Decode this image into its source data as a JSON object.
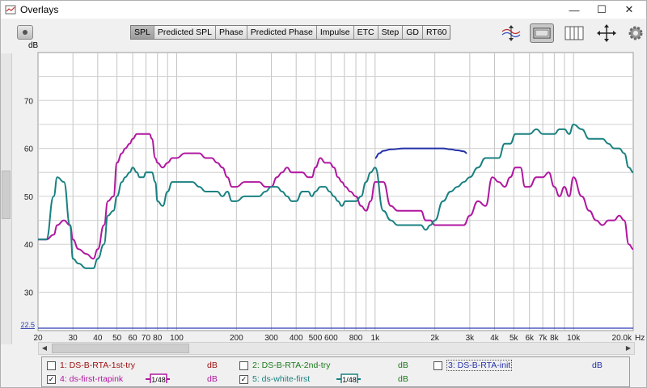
{
  "window": {
    "title": "Overlays",
    "minimize": "—",
    "maximize": "☐",
    "close": "✕"
  },
  "toolbar": {
    "tabs": [
      {
        "label": "SPL",
        "active": true
      },
      {
        "label": "Predicted SPL",
        "active": false
      },
      {
        "label": "Phase",
        "active": false
      },
      {
        "label": "Predicted Phase",
        "active": false
      },
      {
        "label": "Impulse",
        "active": false
      },
      {
        "label": "ETC",
        "active": false
      },
      {
        "label": "Step",
        "active": false
      },
      {
        "label": "GD",
        "active": false
      },
      {
        "label": "RT60",
        "active": false
      }
    ],
    "icons": [
      "vertical-zoom-icon",
      "display-range-icon",
      "grid-columns-icon",
      "expand-axes-icon",
      "settings-gear-icon"
    ]
  },
  "chart_data": {
    "type": "line",
    "ylabel": "dB",
    "xlabel": "Hz",
    "xscale": "log",
    "xlim": [
      20,
      20000
    ],
    "ylim": [
      22,
      80
    ],
    "yticks": [
      30,
      40,
      50,
      60,
      70
    ],
    "xticks": [
      20,
      30,
      40,
      50,
      60,
      70,
      80,
      100,
      200,
      300,
      400,
      500,
      600,
      800,
      1000,
      2000,
      3000,
      4000,
      5000,
      6000,
      7000,
      8000,
      10000,
      20000
    ],
    "xtick_labels": [
      "20",
      "30",
      "40",
      "50",
      "60",
      "70",
      "80",
      "100",
      "200",
      "300",
      "400",
      "500",
      "600",
      "800",
      "1k",
      "2k",
      "3k",
      "4k",
      "5k",
      "6k",
      "7k",
      "8k",
      "10k",
      "20.0k"
    ],
    "reference_line": {
      "value": 22.5,
      "label": "22.5",
      "color": "#2b3bb0"
    },
    "grid": true,
    "series": [
      {
        "name": "ds-first-rtapink",
        "color": "#b0179f",
        "x": [
          20,
          22,
          24,
          25,
          27,
          29,
          30,
          32,
          35,
          38,
          40,
          43,
          45,
          48,
          50,
          53,
          55,
          58,
          60,
          63,
          65,
          68,
          70,
          73,
          75,
          78,
          80,
          85,
          90,
          95,
          100,
          110,
          120,
          130,
          140,
          150,
          160,
          170,
          180,
          190,
          200,
          220,
          240,
          260,
          280,
          300,
          320,
          340,
          360,
          380,
          400,
          430,
          460,
          480,
          500,
          530,
          560,
          590,
          620,
          650,
          680,
          710,
          750,
          800,
          850,
          900,
          950,
          1000,
          1100,
          1200,
          1300,
          1400,
          1500,
          1600,
          1700,
          1800,
          1900,
          2000,
          2200,
          2400,
          2600,
          2800,
          3000,
          3300,
          3600,
          3900,
          4200,
          4500,
          4800,
          5100,
          5400,
          5700,
          6000,
          6500,
          7000,
          7500,
          8000,
          8500,
          9000,
          9500,
          10000,
          11000,
          12000,
          13000,
          14000,
          15000,
          16000,
          17000,
          18000,
          19000,
          20000
        ],
        "y": [
          41,
          41,
          42,
          44,
          45,
          44,
          41,
          39,
          38,
          37,
          39,
          44,
          49,
          50,
          57,
          59,
          60,
          61,
          62,
          63,
          63,
          63,
          63,
          63,
          62,
          58,
          57,
          56,
          57,
          58,
          58,
          59,
          59,
          59,
          58,
          58,
          57,
          56,
          54,
          52,
          52,
          53,
          53,
          53,
          52,
          52,
          54,
          55,
          56,
          55,
          55,
          55,
          54,
          54,
          56,
          58,
          57,
          57,
          56,
          54,
          53,
          52,
          51,
          50,
          48,
          47,
          49,
          53,
          53,
          48,
          47,
          47,
          47,
          47,
          47,
          45,
          45,
          44,
          44,
          44,
          44,
          44,
          46,
          49,
          48,
          54,
          53,
          52,
          54,
          56,
          56,
          52,
          52,
          54,
          54,
          55,
          52,
          50,
          52,
          50,
          54,
          50,
          47,
          45,
          44,
          45,
          45,
          46,
          45,
          40,
          39
        ]
      },
      {
        "name": "ds-white-first",
        "color": "#1a8080",
        "x": [
          20,
          22,
          24,
          25,
          27,
          29,
          30,
          32,
          35,
          38,
          40,
          43,
          45,
          48,
          50,
          53,
          55,
          58,
          60,
          63,
          65,
          68,
          70,
          73,
          75,
          78,
          80,
          85,
          90,
          95,
          100,
          110,
          120,
          130,
          140,
          150,
          160,
          170,
          180,
          190,
          200,
          220,
          240,
          260,
          280,
          300,
          320,
          340,
          360,
          380,
          400,
          430,
          460,
          480,
          500,
          530,
          560,
          590,
          620,
          650,
          680,
          710,
          750,
          800,
          850,
          900,
          950,
          1000,
          1100,
          1200,
          1300,
          1400,
          1500,
          1600,
          1700,
          1800,
          1900,
          2000,
          2200,
          2400,
          2600,
          2800,
          3000,
          3300,
          3600,
          3900,
          4200,
          4500,
          4800,
          5100,
          5400,
          5700,
          6000,
          6500,
          7000,
          7500,
          8000,
          8500,
          9000,
          9500,
          10000,
          11000,
          12000,
          13000,
          14000,
          15000,
          16000,
          17000,
          18000,
          19000,
          20000
        ],
        "y": [
          41,
          41,
          50,
          54,
          53,
          44,
          37,
          36,
          35,
          35,
          37,
          40,
          46,
          47,
          50,
          53,
          54,
          55,
          56,
          55,
          54,
          54,
          55,
          55,
          55,
          53,
          49,
          48,
          51,
          53,
          53,
          53,
          53,
          52,
          51,
          51,
          51,
          50,
          51,
          49,
          49,
          50,
          50,
          50,
          51,
          52,
          52,
          51,
          50,
          49,
          49,
          51,
          51,
          50,
          51,
          52,
          52,
          51,
          50,
          49,
          48,
          49,
          49,
          49,
          50,
          53,
          55,
          56,
          47,
          45,
          44,
          44,
          44,
          44,
          44,
          43,
          44,
          45,
          49,
          51,
          52,
          53,
          54,
          56,
          58,
          58,
          58,
          61,
          61,
          63,
          63,
          63,
          63,
          64,
          63,
          63,
          63,
          64,
          64,
          63,
          65,
          64,
          62,
          62,
          62,
          61,
          60,
          60,
          59,
          56,
          55
        ]
      },
      {
        "name": "DS-B-RTA-init",
        "color": "#2330a8",
        "x": [
          1000,
          1050,
          1100,
          1200,
          1400,
          1600,
          1800,
          2000,
          2200,
          2400,
          2600,
          2800,
          2900
        ],
        "y": [
          58,
          59,
          59.5,
          59.8,
          60,
          60,
          60,
          60,
          60,
          59.8,
          59.6,
          59.4,
          59
        ]
      }
    ]
  },
  "legend": [
    {
      "label": "1: DS-B-RTA-1st-try",
      "unit": "dB",
      "checked": false,
      "color": "#a01010",
      "unit_color": "#a01010"
    },
    {
      "label": "2: DS-B-RTA-2nd-try",
      "unit": "dB",
      "checked": false,
      "color": "#1a7a1a",
      "unit_color": "#1a7a1a"
    },
    {
      "label": "3: DS-B-RTA-init",
      "unit": "dB",
      "checked": false,
      "color": "#2330a8",
      "unit_color": "#2330a8"
    },
    {
      "label": "4: ds-first-rtapink",
      "unit": "dB",
      "checked": true,
      "color": "#b0179f",
      "unit_color": "#b0179f",
      "swatch": "1/48"
    },
    {
      "label": "5: ds-white-first",
      "unit": "dB",
      "checked": true,
      "color": "#1a8080",
      "unit_color": "#1a7a1a",
      "swatch": "1/48"
    }
  ]
}
